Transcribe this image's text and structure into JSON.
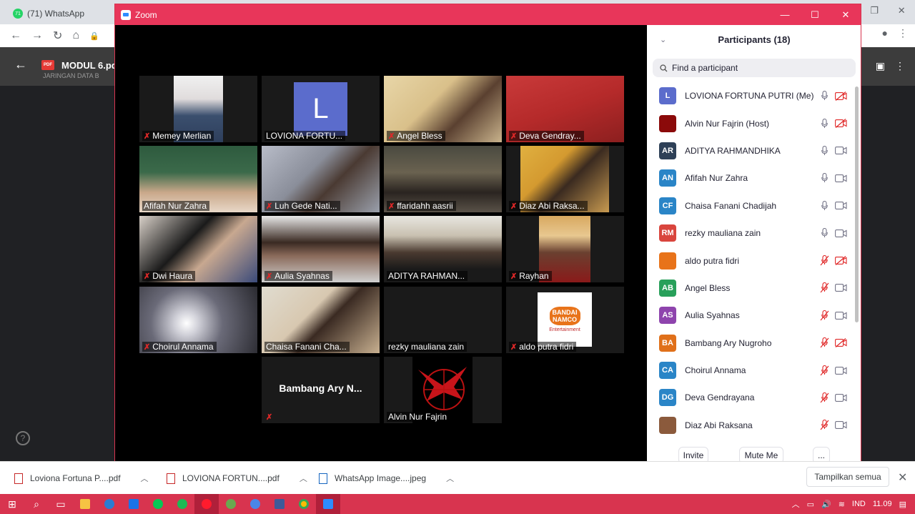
{
  "browser": {
    "tab_title": "(71) WhatsApp",
    "tab_badge": "71",
    "pdf_title": "MODUL 6.pd",
    "pdf_subtitle": "JARINGAN DATA B"
  },
  "zoom": {
    "title": "Zoom",
    "tiles": [
      {
        "name": "Memey Merlian",
        "muted": true
      },
      {
        "name": "LOVIONA FORTU...",
        "muted": false,
        "avatar_letter": "L"
      },
      {
        "name": "Angel Bless",
        "muted": true
      },
      {
        "name": "Deva Gendray...",
        "muted": true
      },
      {
        "name": "Afifah Nur Zahra",
        "muted": false,
        "active": true
      },
      {
        "name": "Luh Gede Nati...",
        "muted": true
      },
      {
        "name": "ffaridahh aasrii",
        "muted": true
      },
      {
        "name": "Diaz Abi Raksa...",
        "muted": true
      },
      {
        "name": "Dwi Haura",
        "muted": true
      },
      {
        "name": "Aulia Syahnas",
        "muted": true
      },
      {
        "name": "ADITYA RAHMAN...",
        "muted": false
      },
      {
        "name": "Rayhan",
        "muted": true
      },
      {
        "name": "Choirul Annama",
        "muted": true
      },
      {
        "name": "Chaisa Fanani Cha...",
        "muted": false
      },
      {
        "name": "rezky mauliana zain",
        "muted": false
      },
      {
        "name": "aldo putra fidri",
        "muted": true,
        "logo_lines": [
          "BANDAI",
          "NAMCO",
          "Entertainment"
        ]
      },
      {
        "name": "Bambang Ary N...",
        "muted": true,
        "no_video": true
      },
      {
        "name": "Alvin Nur Fajrin",
        "muted": false
      }
    ],
    "participants": {
      "title": "Participants (18)",
      "search_placeholder": "Find a participant",
      "list": [
        {
          "name": "LOVIONA FORTUNA PUTRI (Me)",
          "initials": "L",
          "color": "#5b6ccc",
          "mic": "on",
          "cam": "off"
        },
        {
          "name": "Alvin Nur Fajrin (Host)",
          "initials": "",
          "color": "#8b0a0a",
          "mic": "on",
          "cam": "off"
        },
        {
          "name": "ADITYA RAHMANDHIKA",
          "initials": "AR",
          "color": "#2e4057",
          "mic": "on",
          "cam": "on"
        },
        {
          "name": "Afifah Nur Zahra",
          "initials": "AN",
          "color": "#2a85c7",
          "mic": "on",
          "cam": "on"
        },
        {
          "name": "Chaisa Fanani Chadijah",
          "initials": "CF",
          "color": "#2a85c7",
          "mic": "on",
          "cam": "on"
        },
        {
          "name": "rezky mauliana zain",
          "initials": "RM",
          "color": "#d9453d",
          "mic": "on",
          "cam": "on"
        },
        {
          "name": "aldo putra fidri",
          "initials": "",
          "color": "#e8731a",
          "mic": "off",
          "cam": "off"
        },
        {
          "name": "Angel Bless",
          "initials": "AB",
          "color": "#28a05a",
          "mic": "off",
          "cam": "on"
        },
        {
          "name": "Aulia Syahnas",
          "initials": "AS",
          "color": "#8e44ad",
          "mic": "off",
          "cam": "on"
        },
        {
          "name": "Bambang Ary Nugroho",
          "initials": "BA",
          "color": "#e0701a",
          "mic": "off",
          "cam": "off"
        },
        {
          "name": "Choirul Annama",
          "initials": "CA",
          "color": "#2a85c7",
          "mic": "off",
          "cam": "on"
        },
        {
          "name": "Deva Gendrayana",
          "initials": "DG",
          "color": "#2a85c7",
          "mic": "off",
          "cam": "on"
        },
        {
          "name": "Diaz Abi Raksana",
          "initials": "",
          "color": "#8b5a3c",
          "mic": "off",
          "cam": "on"
        }
      ],
      "invite_label": "Invite",
      "mute_me_label": "Mute Me",
      "more_label": "..."
    }
  },
  "downloads": {
    "items": [
      {
        "name": "Loviona Fortuna P....pdf",
        "type": "pdf"
      },
      {
        "name": "LOVIONA FORTUN....pdf",
        "type": "pdf"
      },
      {
        "name": "WhatsApp Image....jpeg",
        "type": "image"
      }
    ],
    "show_all_label": "Tampilkan semua"
  },
  "taskbar": {
    "language": "IND",
    "time": "11.09"
  }
}
